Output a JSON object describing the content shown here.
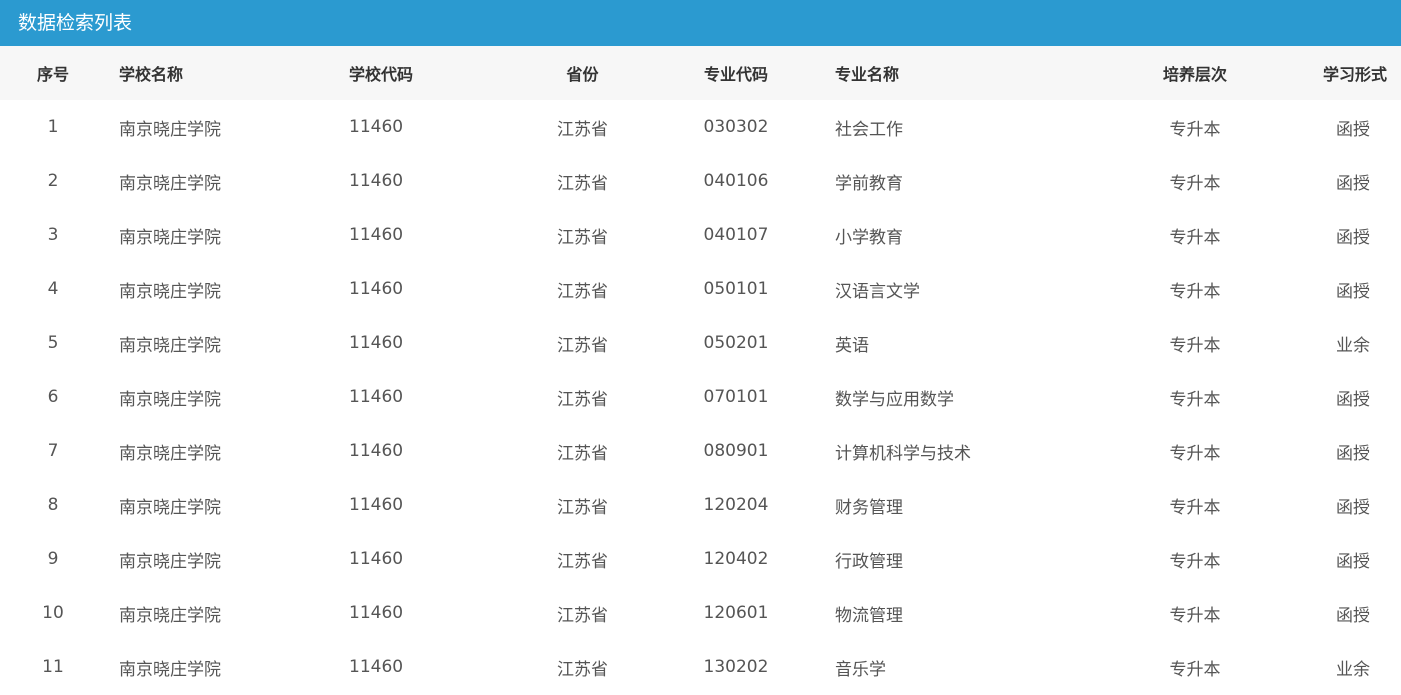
{
  "panel": {
    "title": "数据检索列表"
  },
  "table": {
    "headers": [
      "序号",
      "学校名称",
      "学校代码",
      "省份",
      "专业代码",
      "专业名称",
      "培养层次",
      "学习形式"
    ],
    "rows": [
      [
        "1",
        "南京晓庄学院",
        "11460",
        "江苏省",
        "030302",
        "社会工作",
        "专升本",
        "函授"
      ],
      [
        "2",
        "南京晓庄学院",
        "11460",
        "江苏省",
        "040106",
        "学前教育",
        "专升本",
        "函授"
      ],
      [
        "3",
        "南京晓庄学院",
        "11460",
        "江苏省",
        "040107",
        "小学教育",
        "专升本",
        "函授"
      ],
      [
        "4",
        "南京晓庄学院",
        "11460",
        "江苏省",
        "050101",
        "汉语言文学",
        "专升本",
        "函授"
      ],
      [
        "5",
        "南京晓庄学院",
        "11460",
        "江苏省",
        "050201",
        "英语",
        "专升本",
        "业余"
      ],
      [
        "6",
        "南京晓庄学院",
        "11460",
        "江苏省",
        "070101",
        "数学与应用数学",
        "专升本",
        "函授"
      ],
      [
        "7",
        "南京晓庄学院",
        "11460",
        "江苏省",
        "080901",
        "计算机科学与技术",
        "专升本",
        "函授"
      ],
      [
        "8",
        "南京晓庄学院",
        "11460",
        "江苏省",
        "120204",
        "财务管理",
        "专升本",
        "函授"
      ],
      [
        "9",
        "南京晓庄学院",
        "11460",
        "江苏省",
        "120402",
        "行政管理",
        "专升本",
        "函授"
      ],
      [
        "10",
        "南京晓庄学院",
        "11460",
        "江苏省",
        "120601",
        "物流管理",
        "专升本",
        "函授"
      ],
      [
        "11",
        "南京晓庄学院",
        "11460",
        "江苏省",
        "130202",
        "音乐学",
        "专升本",
        "业余"
      ]
    ]
  }
}
